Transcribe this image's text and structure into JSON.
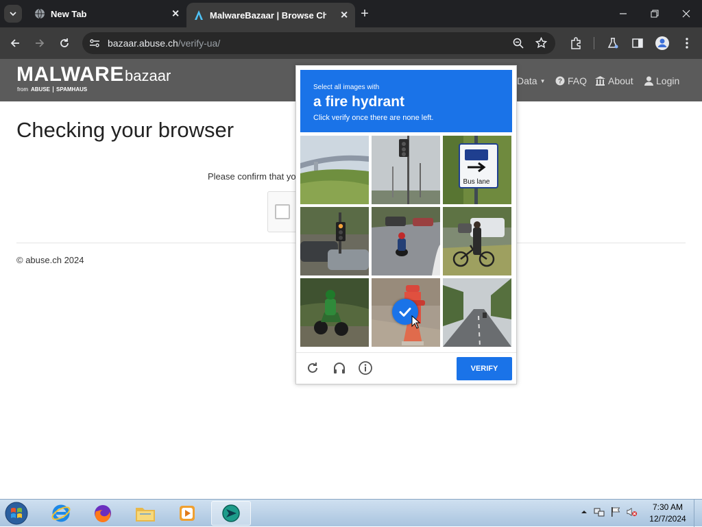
{
  "browser": {
    "tabs": [
      {
        "title": "New Tab"
      },
      {
        "title": "MalwareBazaar | Browse Checked"
      }
    ],
    "url_host": "bazaar.abuse.ch",
    "url_path": "/verify-ua/"
  },
  "site": {
    "logo_main": "MALWARE",
    "logo_sub": "bazaar",
    "logo_by": "from",
    "logo_abuse": "ABUSE",
    "logo_spamhaus": "SPAMHAUS",
    "nav": {
      "data": "Data",
      "faq": "FAQ",
      "about": "About",
      "login": "Login"
    },
    "page_title": "Checking your browser",
    "confirm_text": "Please confirm that you",
    "copyright": "© abuse.ch 2024"
  },
  "captcha": {
    "line1": "Select all images with",
    "line2": "a fire hydrant",
    "line3": "Click verify once there are none left.",
    "bus_sign_text": "Bus lane",
    "verify_label": "VERIFY",
    "selected_index": 7
  },
  "taskbar": {
    "time": "7:30 AM",
    "date": "12/7/2024"
  },
  "colors": {
    "accent": "#1a73e8",
    "header_bg": "#5b5b5b"
  }
}
